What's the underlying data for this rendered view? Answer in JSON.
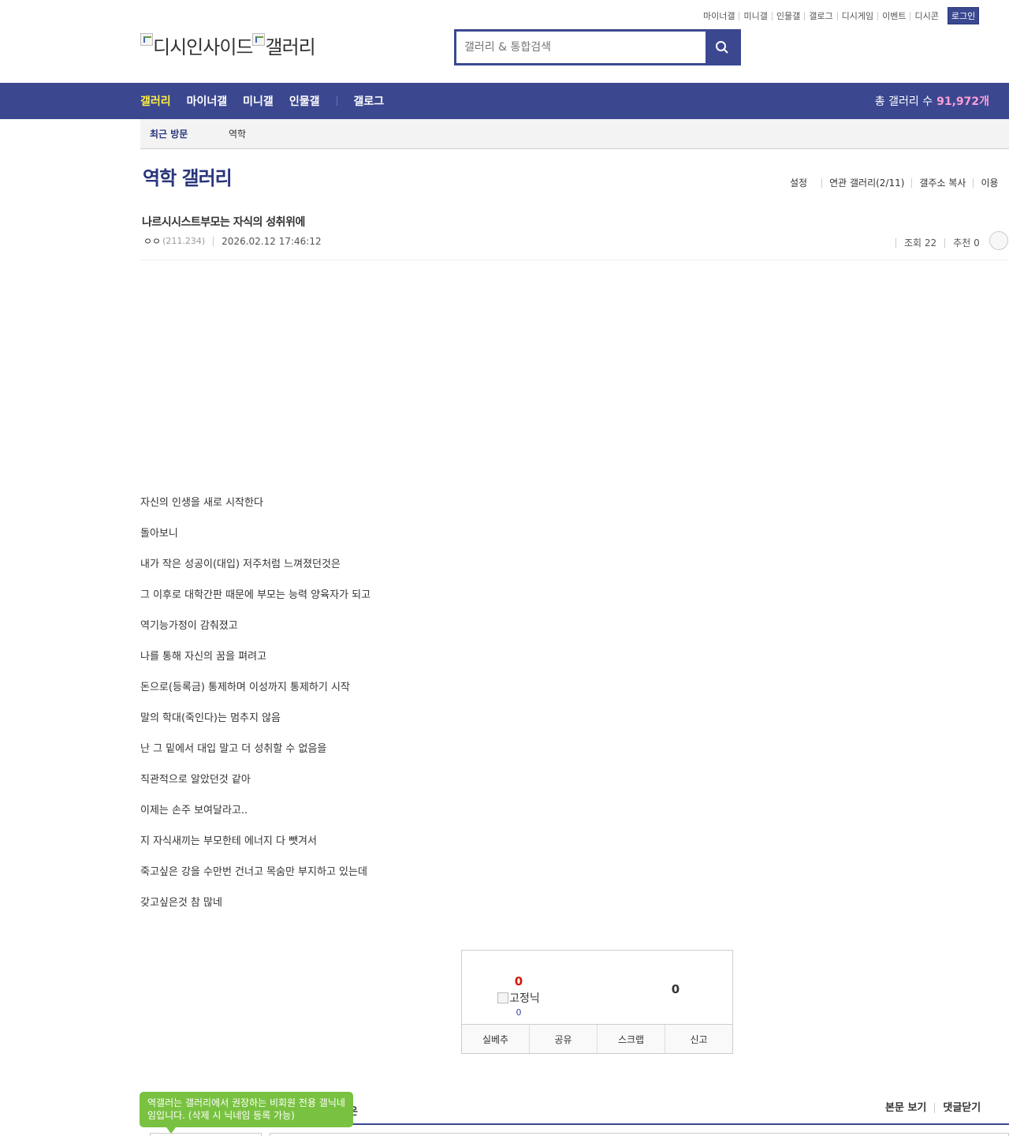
{
  "util_links": [
    "마이너갤",
    "미니갤",
    "인물갤",
    "갤로그",
    "디시게임",
    "이벤트",
    "디시콘"
  ],
  "login_label": "로그인",
  "logo": {
    "site": "디시인사이드",
    "gallery": "갤러리"
  },
  "search": {
    "placeholder": "갤러리 & 통합검색"
  },
  "gnb": {
    "items": [
      "갤러리",
      "마이너갤",
      "미니갤",
      "인물갤",
      "갤로그"
    ],
    "count_label": "총 갤러리 수",
    "count_value": "91,972개"
  },
  "recent": {
    "title": "최근 방문",
    "gallery": "역학"
  },
  "gallery_title": "역학 갤러리",
  "gallery_options": [
    "설정",
    "연관 갤러리(2/11)",
    "갤주소 복사",
    "이용"
  ],
  "post": {
    "title": "나르시시스트부모는 자식의 성취위에",
    "nick": "ㅇㅇ",
    "ip": "(211.234)",
    "date": "2026.02.12 17:46:12",
    "views": "조회 22",
    "recommend": "추천 0",
    "body": [
      "자신의 인생을 새로 시작한다",
      "돌아보니",
      "내가 작은 성공이(대입) 저주처럼 느껴졌던것은",
      "그 이후로 대학간판 때문에 부모는 능력 양육자가 되고",
      "역기능가정이 감춰졌고",
      "나를 통해 자신의 꿈을 펴려고",
      "돈으로(등록금) 통제하며 이성까지 통제하기 시작",
      "말의 학대(죽인다)는 멈추지 않음",
      "난 그 밑에서 대입 말고 더 성취할 수 없음을",
      "직관적으로 알았던것 같아",
      "이제는 손주 보여달라고..",
      "지 자식새끼는 부모한테 에너지 다 뺏겨서",
      "죽고싶은 강을 수만번 건너고 목숨만 부지하고 있는데",
      "갖고싶은것 참 많네"
    ]
  },
  "recommend_box": {
    "up_count": "0",
    "fixed_nick_label": "고정닉",
    "fixed_nick_count": "0",
    "down_count": "0",
    "actions": [
      "실베추",
      "공유",
      "스크랩",
      "신고"
    ]
  },
  "comments": {
    "header_fragment": "은",
    "tabs": [
      "본문 보기",
      "댓글닫기"
    ]
  },
  "tooltip": "역갤러는 갤러리에서 권장하는 비회원 전용 갤닉네임입니다. (삭제 시 닉네임 등록 가능)",
  "colors": {
    "brand": "#3b4890",
    "gnb_active": "#ffed45",
    "count": "#ff9dd6",
    "tooltip": "#79c241",
    "recommend": "#d31900"
  }
}
